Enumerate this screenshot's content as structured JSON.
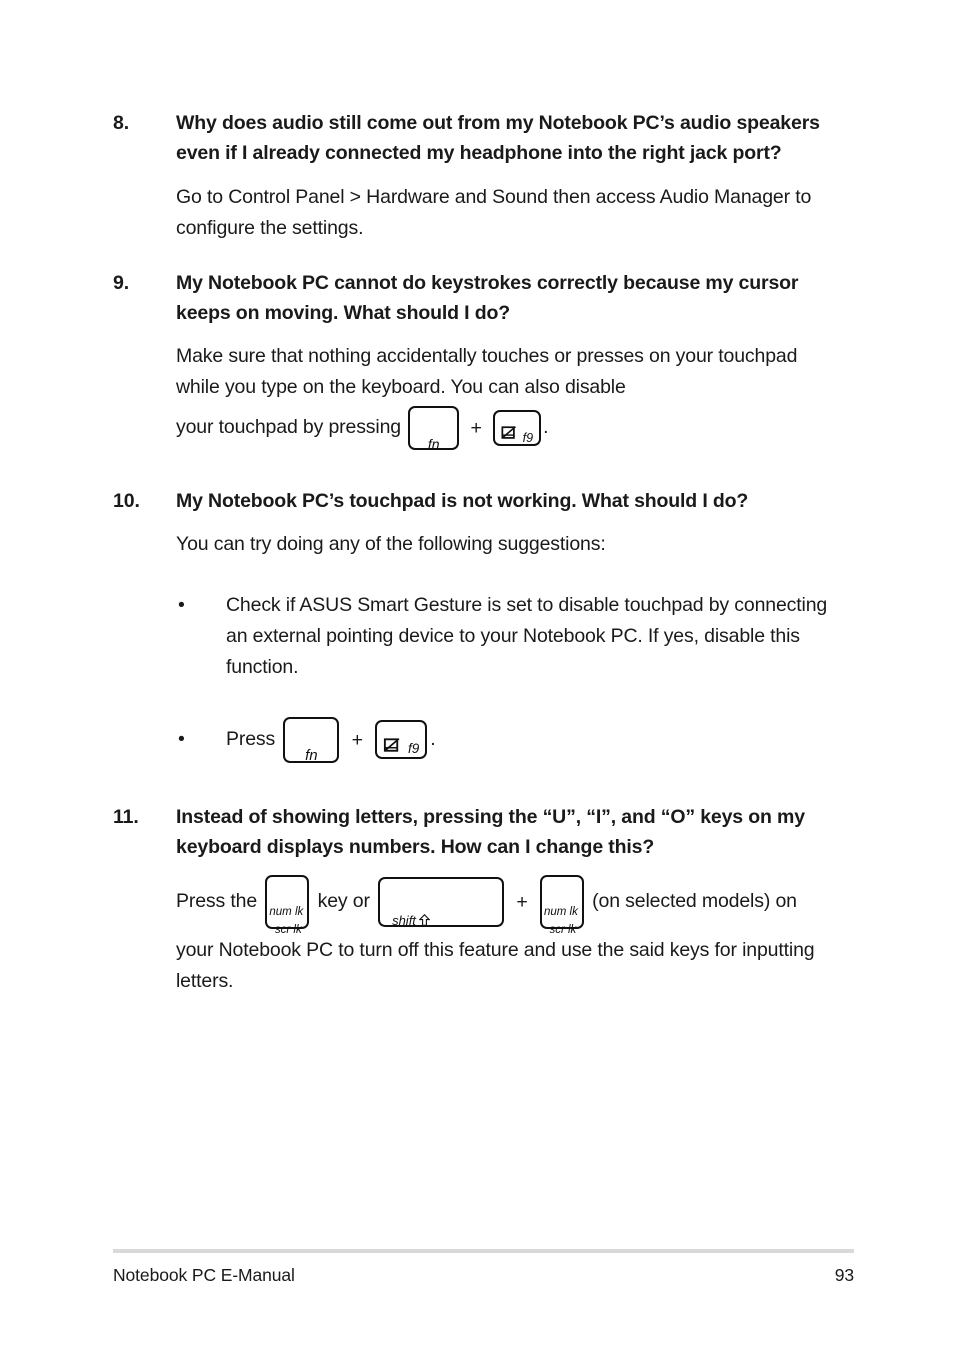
{
  "document": {
    "title": "Notebook PC E-Manual",
    "page_number": "93",
    "footer_rule_color": "#d9d9d9",
    "text_color": "#1a1a1a",
    "background_color": "#ffffff"
  },
  "faq": [
    {
      "number": "8.",
      "question": "Why does audio still come out from my Notebook PC’s audio speakers even if I already connected my headphone into the right jack port?",
      "answer": "Go to Control Panel > Hardware and Sound then access Audio Manager to configure the settings."
    },
    {
      "number": "9.",
      "question": "My Notebook PC cannot do keystrokes correctly because my cursor keeps on moving. What should I do?",
      "answer_part1": "Make sure that nothing accidentally touches or presses on your touchpad while you type on the keyboard. You can also disable",
      "answer_part2": "your touchpad by pressing",
      "answer_part3": ".",
      "keys": {
        "fn": "fn",
        "plus": "+",
        "f9": "f9",
        "f9_icon": "touchpad-disabled-icon"
      }
    },
    {
      "number": "10.",
      "question": "My Notebook PC’s touchpad is not working. What should I do?",
      "answer": "You can try doing any of the following suggestions:",
      "bullets": [
        {
          "marker": "•",
          "text": "Check if ASUS Smart Gesture is set to disable touchpad by connecting an external pointing device to your Notebook PC. If yes, disable this function."
        },
        {
          "marker": "•",
          "text_before": "Press",
          "text_after": ".",
          "keys": {
            "fn": "fn",
            "plus": "+",
            "f9": "f9",
            "f9_icon": "touchpad-disabled-icon"
          }
        }
      ]
    },
    {
      "number": "11.",
      "question": "Instead of showing letters, pressing the “U”, “I”, and “O” keys on my keyboard displays numbers. How can I change this?",
      "answer_seg1": "Press the",
      "answer_seg2": "key or",
      "answer_seg3": "+",
      "answer_seg4": "(on selected models) on",
      "answer_seg5": "your Notebook PC to turn off this feature and use the said keys for inputting letters.",
      "keys": {
        "numlk_line1": "num lk",
        "numlk_line2": "scr lk",
        "shift": "shift",
        "shift_arrow_icon": "shift-up-arrow-icon"
      }
    }
  ]
}
